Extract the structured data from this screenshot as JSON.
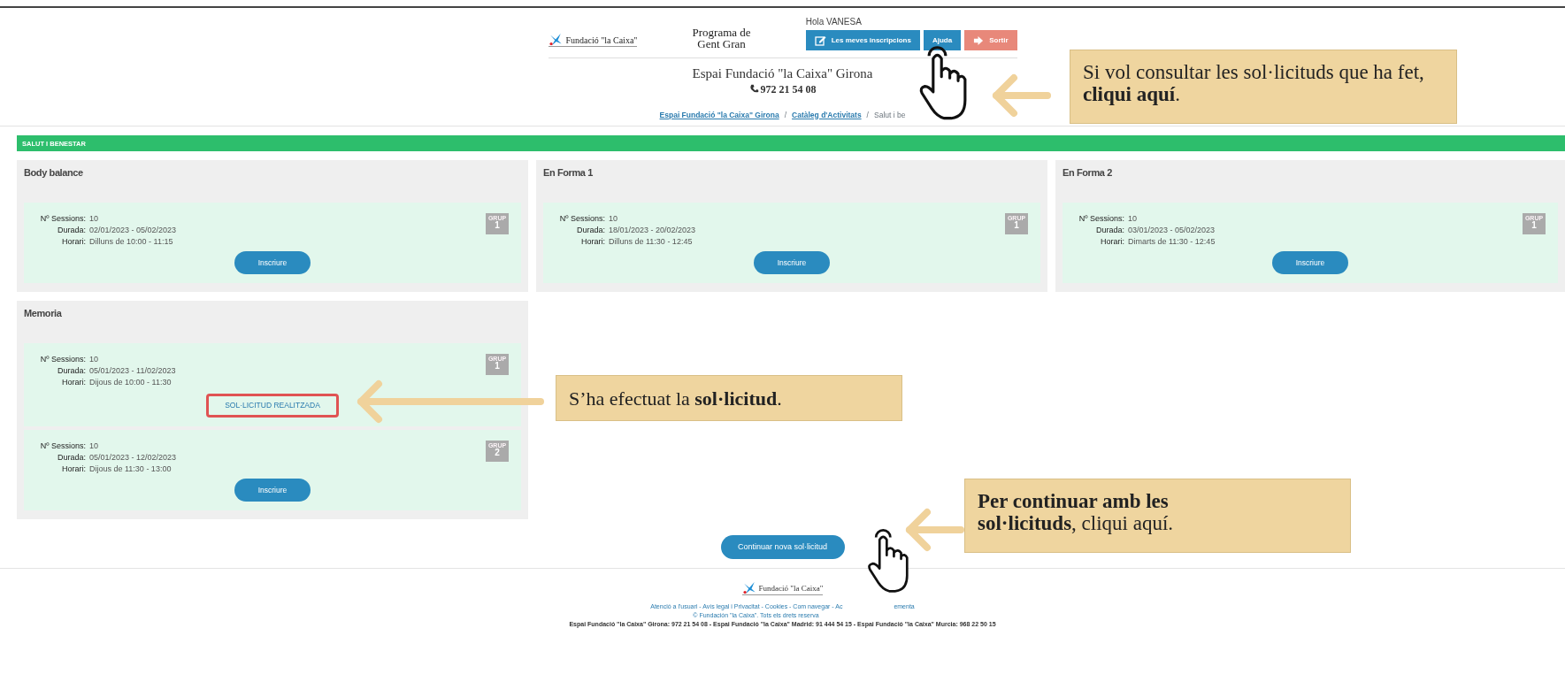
{
  "header": {
    "logo_text": "Fundació \"la Caixa\"",
    "program_title": [
      "Programa de",
      "Gent Gran"
    ],
    "greeting": "Hola VANESA",
    "buttons": [
      {
        "label": "Les meves inscripcions",
        "kind": "primary"
      },
      {
        "label": "Ajuda",
        "kind": "primary"
      },
      {
        "label": "Sortir",
        "kind": "danger"
      }
    ],
    "centre_name": "Espai Fundació \"la Caixa\" Girona",
    "phone": "972 21 54 08",
    "breadcrumb": [
      {
        "label": "Espai Fundació \"la Caixa\" Girona",
        "kind": "link"
      },
      {
        "label": "Catàleg d'Activitats",
        "kind": "link"
      },
      {
        "label": "Salut i be",
        "kind": "current"
      }
    ],
    "breadcrumb_separator": "/"
  },
  "section_title": "SALUT I BENESTAR",
  "activities": [
    {
      "title": "Body balance",
      "groups": [
        {
          "badge_label": "GRUP",
          "badge_number": "1",
          "fields": [
            {
              "label": "Nº Sessions:",
              "value": "10"
            },
            {
              "label": "Durada:",
              "value": "02/01/2023 - 05/02/2023"
            },
            {
              "label": "Horari:",
              "value": "Dilluns de 10:00 - 11:15"
            }
          ],
          "action": {
            "kind": "button",
            "label": "Inscriure"
          }
        }
      ]
    },
    {
      "title": "En Forma 1",
      "groups": [
        {
          "badge_label": "GRUP",
          "badge_number": "1",
          "fields": [
            {
              "label": "Nº Sessions:",
              "value": "10"
            },
            {
              "label": "Durada:",
              "value": "18/01/2023 - 20/02/2023"
            },
            {
              "label": "Horari:",
              "value": "Dilluns de 11:30 - 12:45"
            }
          ],
          "action": {
            "kind": "button",
            "label": "Inscriure"
          }
        }
      ]
    },
    {
      "title": "En Forma 2",
      "groups": [
        {
          "badge_label": "GRUP",
          "badge_number": "1",
          "fields": [
            {
              "label": "Nº Sessions:",
              "value": "10"
            },
            {
              "label": "Durada:",
              "value": "03/01/2023 - 05/02/2023"
            },
            {
              "label": "Horari:",
              "value": "Dimarts de 11:30 - 12:45"
            }
          ],
          "action": {
            "kind": "button",
            "label": "Inscriure"
          }
        }
      ]
    },
    {
      "title": "Memoria",
      "groups": [
        {
          "badge_label": "GRUP",
          "badge_number": "1",
          "fields": [
            {
              "label": "Nº Sessions:",
              "value": "10"
            },
            {
              "label": "Durada:",
              "value": "05/01/2023 - 11/02/2023"
            },
            {
              "label": "Horari:",
              "value": "Dijous de 10:00 - 11:30"
            }
          ],
          "action": {
            "kind": "status",
            "label": "SOL·LICITUD REALITZADA",
            "highlighted": true
          }
        },
        {
          "badge_label": "GRUP",
          "badge_number": "2",
          "fields": [
            {
              "label": "Nº Sessions:",
              "value": "10"
            },
            {
              "label": "Durada:",
              "value": "05/01/2023 - 12/02/2023"
            },
            {
              "label": "Horari:",
              "value": "Dijous de 11:30 - 13:00"
            }
          ],
          "action": {
            "kind": "button",
            "label": "Inscriure"
          }
        }
      ]
    }
  ],
  "continue_button": "Continuar nova sol·licitud",
  "footer": {
    "logo_text": "Fundació \"la Caixa\"",
    "links": [
      "Atenció a l'usuari - Avís legal i Privacitat - Cookies - Com navegar - Ac",
      "ementa"
    ],
    "copyright": "© Fundación \"la Caixa\". Tots els drets reserva",
    "addresses": "Espai Fundació \"la Caixa\" Girona: 972 21 54 08 - Espai Fundació \"la Caixa\" Madrid: 91 444 54 15 - Espai Fundació \"la Caixa\" Murcia: 968 22 50 15"
  },
  "annotations": [
    {
      "text": "Si vol consultar les sol·licituds que ha fet, **cliqui aquí**."
    },
    {
      "text": "S’ha efectuat la **sol·licitud**."
    },
    {
      "text": "**Per continuar amb les sol·licituds**, cliqui aquí."
    }
  ]
}
